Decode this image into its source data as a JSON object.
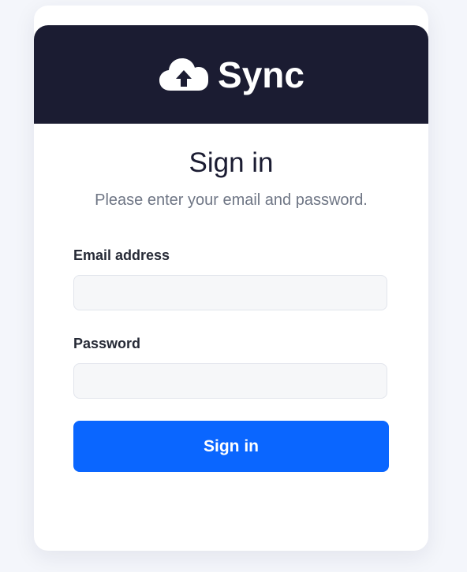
{
  "brand": {
    "name": "Sync",
    "icon": "cloud-upload-icon"
  },
  "form": {
    "title": "Sign in",
    "subtitle": "Please enter your email and password.",
    "email": {
      "label": "Email address",
      "value": "",
      "placeholder": ""
    },
    "password": {
      "label": "Password",
      "value": "",
      "placeholder": ""
    },
    "submit_label": "Sign in"
  },
  "colors": {
    "header_bg": "#1b1c32",
    "accent": "#0a66ff",
    "page_bg": "#f4f6fb"
  }
}
